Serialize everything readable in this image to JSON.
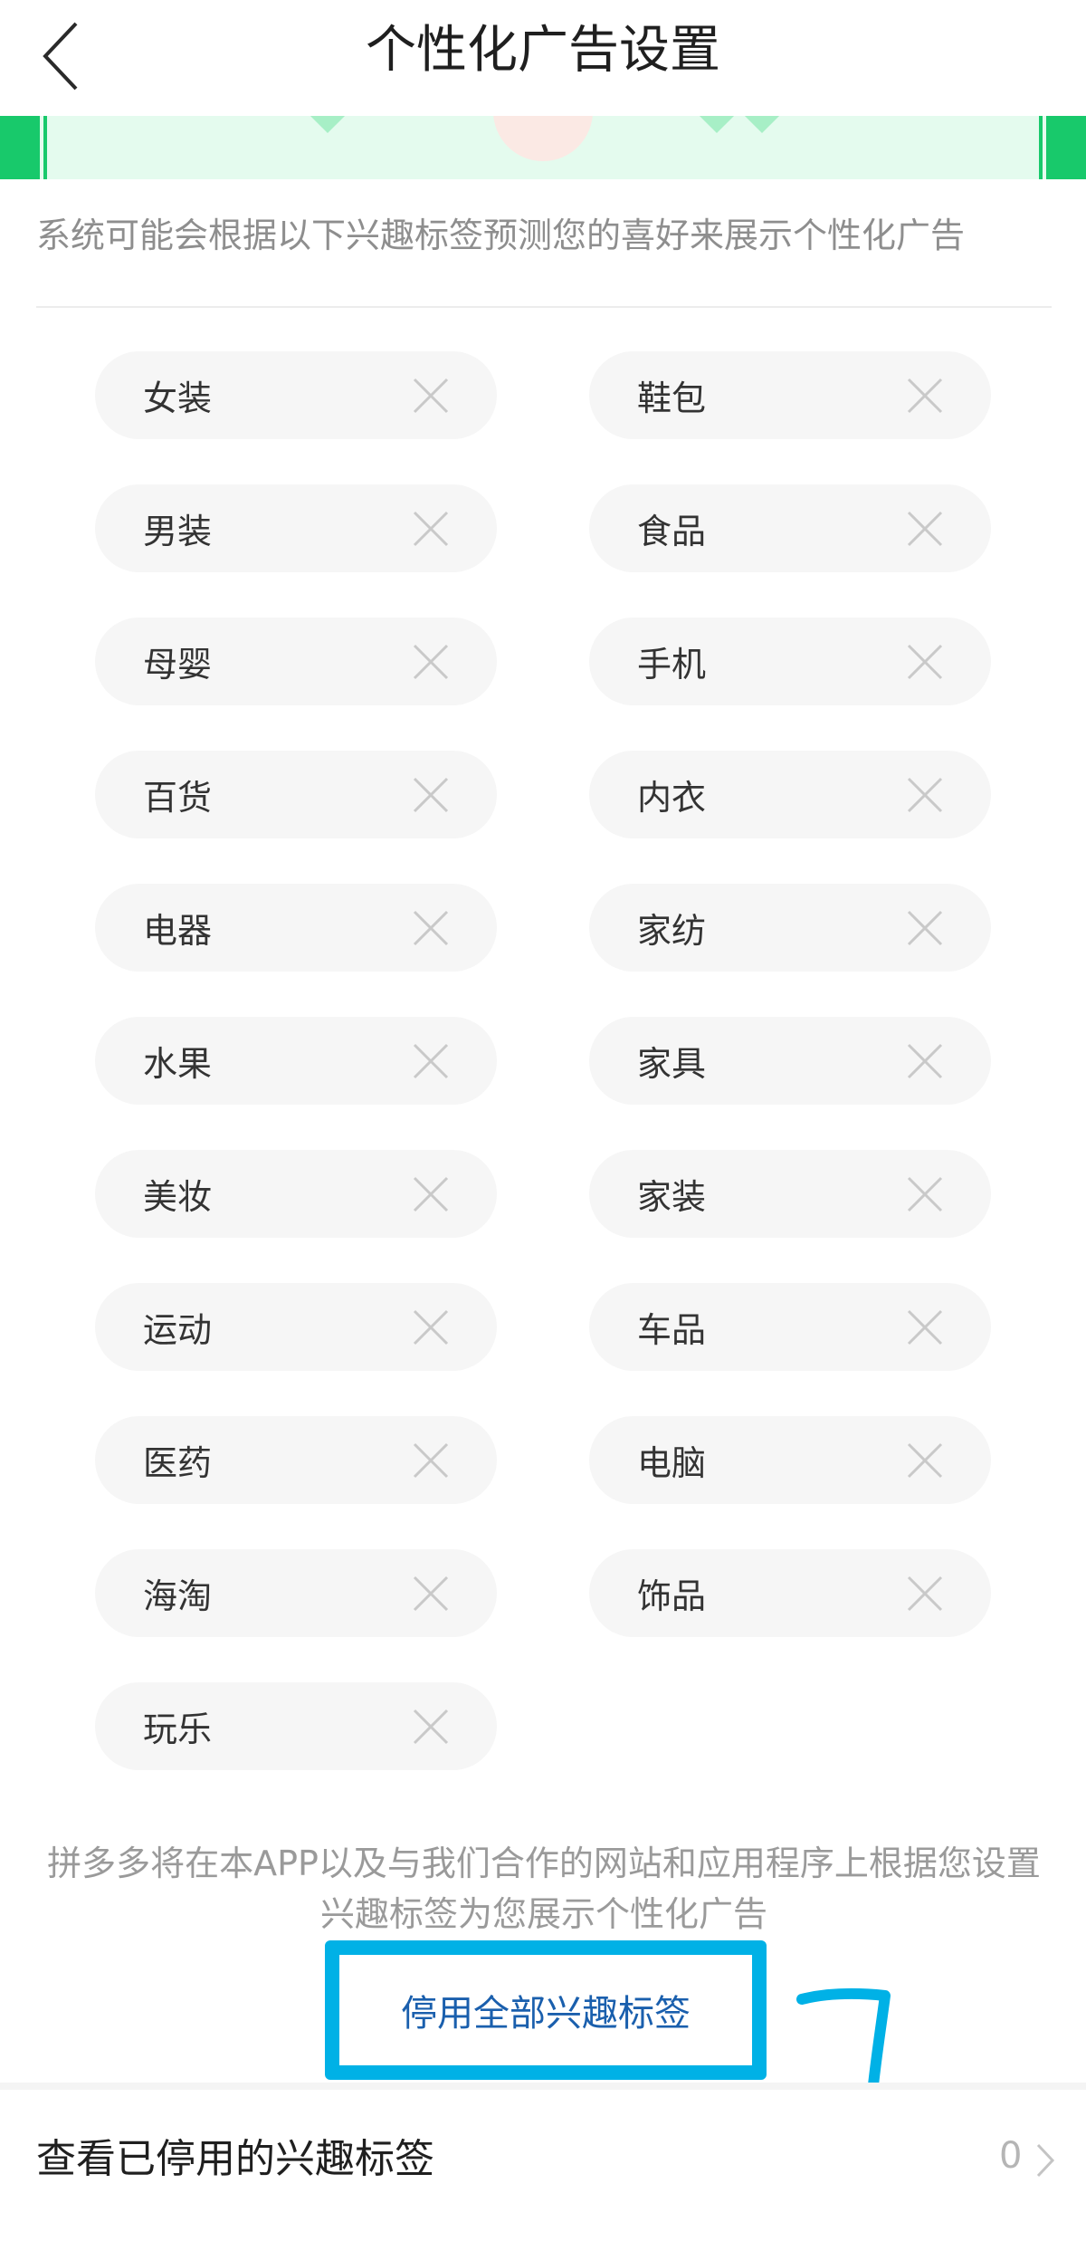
{
  "header": {
    "title": "个性化广告设置",
    "back_icon": "chevron-left-icon"
  },
  "description": "系统可能会根据以下兴趣标签预测您的喜好来展示个性化广告",
  "tags": [
    {
      "label": "女装"
    },
    {
      "label": "鞋包"
    },
    {
      "label": "男装"
    },
    {
      "label": "食品"
    },
    {
      "label": "母婴"
    },
    {
      "label": "手机"
    },
    {
      "label": "百货"
    },
    {
      "label": "内衣"
    },
    {
      "label": "电器"
    },
    {
      "label": "家纺"
    },
    {
      "label": "水果"
    },
    {
      "label": "家具"
    },
    {
      "label": "美妆"
    },
    {
      "label": "家装"
    },
    {
      "label": "运动"
    },
    {
      "label": "车品"
    },
    {
      "label": "医药"
    },
    {
      "label": "电脑"
    },
    {
      "label": "海淘"
    },
    {
      "label": "饰品"
    },
    {
      "label": "玩乐"
    }
  ],
  "footer_note": "拼多多将在本APP以及与我们合作的网站和应用程序上根据您设置兴趣标签为您展示个性化广告",
  "disable_all_button": "停用全部兴趣标签",
  "annotation": {
    "handwritten_number": "7",
    "highlight_color": "#00b1e6"
  },
  "disabled_tags_row": {
    "label": "查看已停用的兴趣标签",
    "count": "0"
  },
  "colors": {
    "accent_link": "#1a5fad",
    "banner_green": "#18c96b",
    "tag_bg": "#f6f6f6"
  }
}
